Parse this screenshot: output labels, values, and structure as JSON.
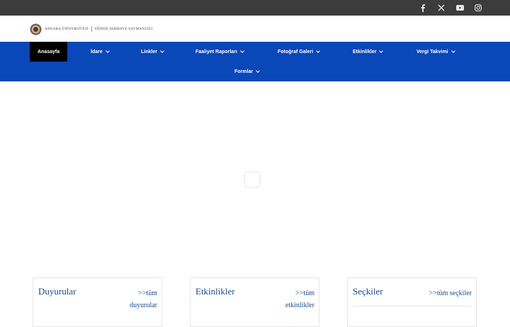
{
  "social": [
    {
      "name": "facebook-icon",
      "glyph": "f"
    },
    {
      "name": "x-twitter-icon",
      "glyph": "X"
    },
    {
      "name": "youtube-icon",
      "glyph": "▶"
    },
    {
      "name": "instagram-icon",
      "glyph": "◎"
    }
  ],
  "logo": {
    "university": "ANKARA ÜNİVERSİTESİ",
    "unit": "DÖNER SERMAYE SAYMANLIĞI"
  },
  "nav": {
    "items": [
      {
        "label": "Anasayfa",
        "dropdown": false,
        "active": true
      },
      {
        "label": "İdare",
        "dropdown": true
      },
      {
        "label": "Linkler",
        "dropdown": true
      },
      {
        "label": "Faaliyet Raporları",
        "dropdown": true
      },
      {
        "label": "Fotoğraf Galeri",
        "dropdown": true
      },
      {
        "label": "Etkinlikler",
        "dropdown": true
      },
      {
        "label": "Vergi Takvimi",
        "dropdown": true
      },
      {
        "label": "Formlar",
        "dropdown": true
      }
    ]
  },
  "cards": [
    {
      "title": "Duyurular",
      "link_line1": ">>tüm",
      "link_line2": "duyurular"
    },
    {
      "title": "Etkinlikler",
      "link_line1": ">>tüm",
      "link_line2": "etkinlikler"
    },
    {
      "title": "Seçkiler",
      "link_line1": ">>tüm seçkiler",
      "link_line2": ""
    }
  ],
  "colors": {
    "topbar": "#3c3c3c",
    "nav": "#0a47b8",
    "nav_active": "#000000",
    "card_text": "#1a4a8a"
  }
}
